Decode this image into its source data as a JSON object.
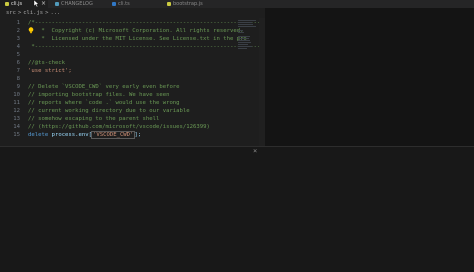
{
  "tabs": [
    {
      "label": "cli.js",
      "active": true,
      "close": "×"
    },
    {
      "label": "CHANGELOG",
      "active": false
    },
    {
      "label": "cli.ts",
      "active": false
    },
    {
      "label": "bootstrap.js",
      "active": false
    }
  ],
  "breadcrumb": [
    "src",
    ">",
    "cli.js",
    ">",
    "..."
  ],
  "line_numbers": [
    "1",
    "2",
    "3",
    "4",
    "5",
    "6",
    "7",
    "8",
    "9",
    "10",
    "11",
    "12",
    "13",
    "14",
    "15"
  ],
  "code_lines": [
    {
      "text": "/*---------------------------------------------------------------------------------------------",
      "kind": "comment"
    },
    {
      "text": " *  Copyright (c) Microsoft Corporation. All rights reserved.",
      "kind": "comment"
    },
    {
      "text": " *  Licensed under the MIT License. See License.txt in the pro",
      "kind": "comment"
    },
    {
      "text": " *--------------------------------------------------------------------------------------------*/",
      "kind": "comment"
    },
    {
      "text": "",
      "kind": "plain"
    },
    {
      "text": "//@ts-check",
      "kind": "comment"
    },
    {
      "text": "'use strict';",
      "kind": "string"
    },
    {
      "text": "",
      "kind": "plain"
    },
    {
      "text": "// Delete `VSCODE_CWD` very early even before",
      "kind": "comment"
    },
    {
      "text": "// importing bootstrap files. We have seen",
      "kind": "comment"
    },
    {
      "text": "// reports where `code .` would use the wrong",
      "kind": "comment"
    },
    {
      "text": "// current working directory due to our variable",
      "kind": "comment"
    },
    {
      "text": "// somehow escaping to the parent shell",
      "kind": "comment"
    },
    {
      "text": "// (https://github.com/microsoft/vscode/issues/126399)",
      "kind": "comment"
    }
  ],
  "line15": {
    "kw": "delete",
    "expr": " process.env[",
    "str": "'VSCODE_CWD'",
    "end": "];"
  },
  "panel_close": "×",
  "colors": {
    "comment": "#6a9955",
    "string": "#ce9178",
    "keyword": "#569cd6",
    "background": "#1e1e1e"
  }
}
